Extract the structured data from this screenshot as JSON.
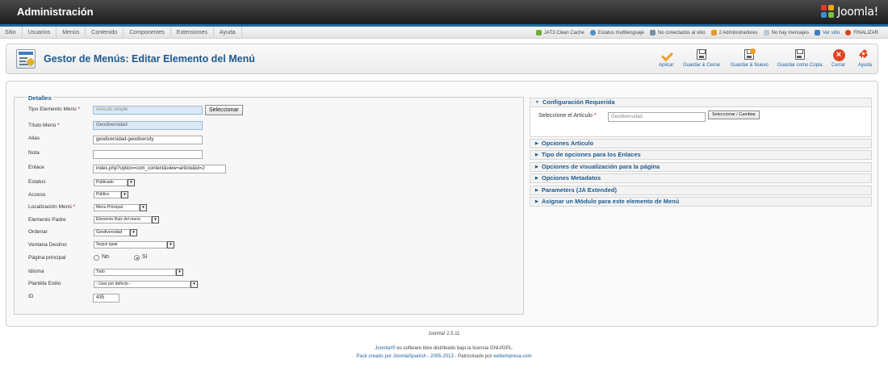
{
  "app": {
    "title": "Administración",
    "brand": "Joomla!"
  },
  "menu": {
    "items": [
      "Sitio",
      "Usuarios",
      "Menús",
      "Contenido",
      "Componentes",
      "Extensiones",
      "Ayuda"
    ]
  },
  "status": {
    "clean_cache": "JAT3 Clean Cache",
    "multilang": "Estatus multilenguaje",
    "visitors": "No conectados al sitio",
    "admins": "2 Administradores",
    "messages": "No hay mensajes",
    "view_site": "Ver sitio",
    "logout": "FINALIZAR"
  },
  "toolbar": {
    "page_title": "Gestor de Menús: Editar Elemento del Menú",
    "apply": "Aplicar",
    "save_close": "Guardar & Cerrar",
    "save_new": "Guardar & Nuevo",
    "save_copy": "Guardar como Copia",
    "close": "Cerrar",
    "help": "Ayuda"
  },
  "details": {
    "legend": "Detalles",
    "fields": {
      "tipo_label": "Tipo Elemento Menú",
      "tipo_value": "Artículo simple",
      "select_button": "Seleccionar",
      "titulo_label": "Título Menú",
      "titulo_value": "Geodiversidad",
      "alias_label": "Alias",
      "alias_value": "geodiversidad-geodiversity",
      "nota_label": "Nota",
      "nota_value": "",
      "enlace_label": "Enlace",
      "enlace_value": "index.php?option=com_content&view=article&id=2",
      "estatus_label": "Estatus",
      "estatus_value": "Publicado",
      "acceso_label": "Acceso",
      "acceso_value": "Público",
      "localizacion_label": "Localización Menú",
      "localizacion_value": "Menu Principal",
      "padre_label": "Elemento Padre",
      "padre_value": "Elemento Raíz del menú",
      "ordenar_label": "Ordenar",
      "ordenar_value": "Geodiversidad",
      "ventana_label": "Ventana Destino",
      "ventana_value": "Seguir igual",
      "pagina_label": "Página principal",
      "pagina_no": "No",
      "pagina_si": "Sí",
      "idioma_label": "Idioma",
      "idioma_value": "Todo",
      "plantilla_label": "Plantilla Estilo",
      "plantilla_value": "- Usar por defecto -",
      "id_label": "ID",
      "id_value": "435"
    }
  },
  "right": {
    "required_title": "Configuración Requerida",
    "article_label": "Seleccione el Artículo",
    "article_value": "Geodiversidad",
    "article_button": "Seleccionar / Cambiar",
    "panels": [
      "Opciones Artículo",
      "Tipo de opciones para los Enlaces",
      "Opciones de visualización para la página",
      "Opciones Metadatos",
      "Parameters (JA Extended)",
      "Asignar un Módulo para este elemento de Menú"
    ]
  },
  "footer": {
    "version": "Joomla! 2.5.11",
    "license_link": "Joomla!®",
    "license_text": " es software libre distribuido bajo la licencia GNU/GPL.",
    "pack_link": "Pack creado por JoomlaSpanish - 2005-2013",
    "sponsor_text": " - Patrocinado por ",
    "sponsor_link": "webempresa.com"
  },
  "colors": {
    "accent": "#1d5a8f",
    "required": "#cc0000",
    "close": "#e1451f",
    "apply": "#f0a020"
  }
}
